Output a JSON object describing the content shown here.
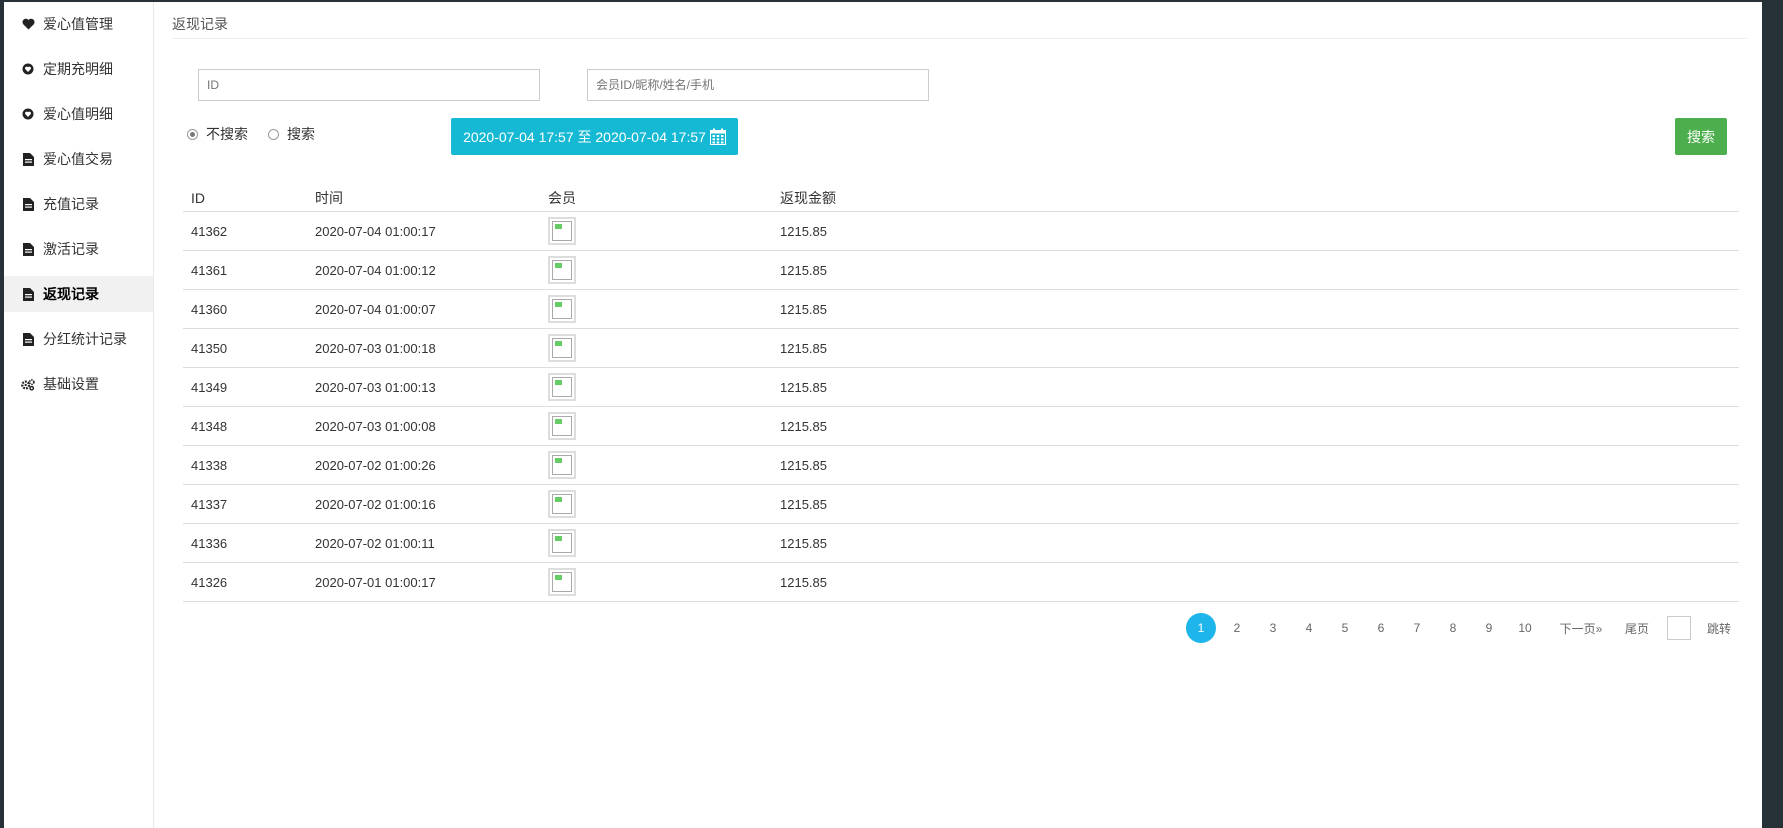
{
  "sidebar": {
    "items": [
      {
        "label": "爱心值管理",
        "icon": "heart-icon",
        "active": false
      },
      {
        "label": "定期充明细",
        "icon": "shield-heart-icon",
        "active": false
      },
      {
        "label": "爱心值明细",
        "icon": "shield-heart-icon",
        "active": false
      },
      {
        "label": "爱心值交易",
        "icon": "document-icon",
        "active": false
      },
      {
        "label": "充值记录",
        "icon": "document-icon",
        "active": false
      },
      {
        "label": "激活记录",
        "icon": "document-icon",
        "active": false
      },
      {
        "label": "返现记录",
        "icon": "document-icon",
        "active": true
      },
      {
        "label": "分红统计记录",
        "icon": "document-icon",
        "active": false
      },
      {
        "label": "基础设置",
        "icon": "gears-icon",
        "active": false
      }
    ]
  },
  "page": {
    "title": "返现记录"
  },
  "filters": {
    "id_placeholder": "ID",
    "member_placeholder": "会员ID/昵称/姓名/手机",
    "radio_no_search": "不搜索",
    "radio_search": "搜索",
    "radio_selected": "不搜索",
    "date_range": "2020-07-04 17:57 至 2020-07-04 17:57",
    "search_button": "搜索"
  },
  "table": {
    "headers": {
      "id": "ID",
      "time": "时间",
      "member": "会员",
      "amount": "返现金额"
    },
    "rows": [
      {
        "id": "41362",
        "time": "2020-07-04 01:00:17",
        "amount": "1215.85"
      },
      {
        "id": "41361",
        "time": "2020-07-04 01:00:12",
        "amount": "1215.85"
      },
      {
        "id": "41360",
        "time": "2020-07-04 01:00:07",
        "amount": "1215.85"
      },
      {
        "id": "41350",
        "time": "2020-07-03 01:00:18",
        "amount": "1215.85"
      },
      {
        "id": "41349",
        "time": "2020-07-03 01:00:13",
        "amount": "1215.85"
      },
      {
        "id": "41348",
        "time": "2020-07-03 01:00:08",
        "amount": "1215.85"
      },
      {
        "id": "41338",
        "time": "2020-07-02 01:00:26",
        "amount": "1215.85"
      },
      {
        "id": "41337",
        "time": "2020-07-02 01:00:16",
        "amount": "1215.85"
      },
      {
        "id": "41336",
        "time": "2020-07-02 01:00:11",
        "amount": "1215.85"
      },
      {
        "id": "41326",
        "time": "2020-07-01 01:00:17",
        "amount": "1215.85"
      }
    ]
  },
  "pagination": {
    "current": "1",
    "pages": [
      "2",
      "3",
      "4",
      "5",
      "6",
      "7",
      "8",
      "9",
      "10"
    ],
    "next": "下一页»",
    "last": "尾页",
    "jump": "跳转"
  },
  "colors": {
    "accent": "#16b9d3",
    "search_button": "#4cae4c",
    "page_current": "#1eb5ea"
  }
}
